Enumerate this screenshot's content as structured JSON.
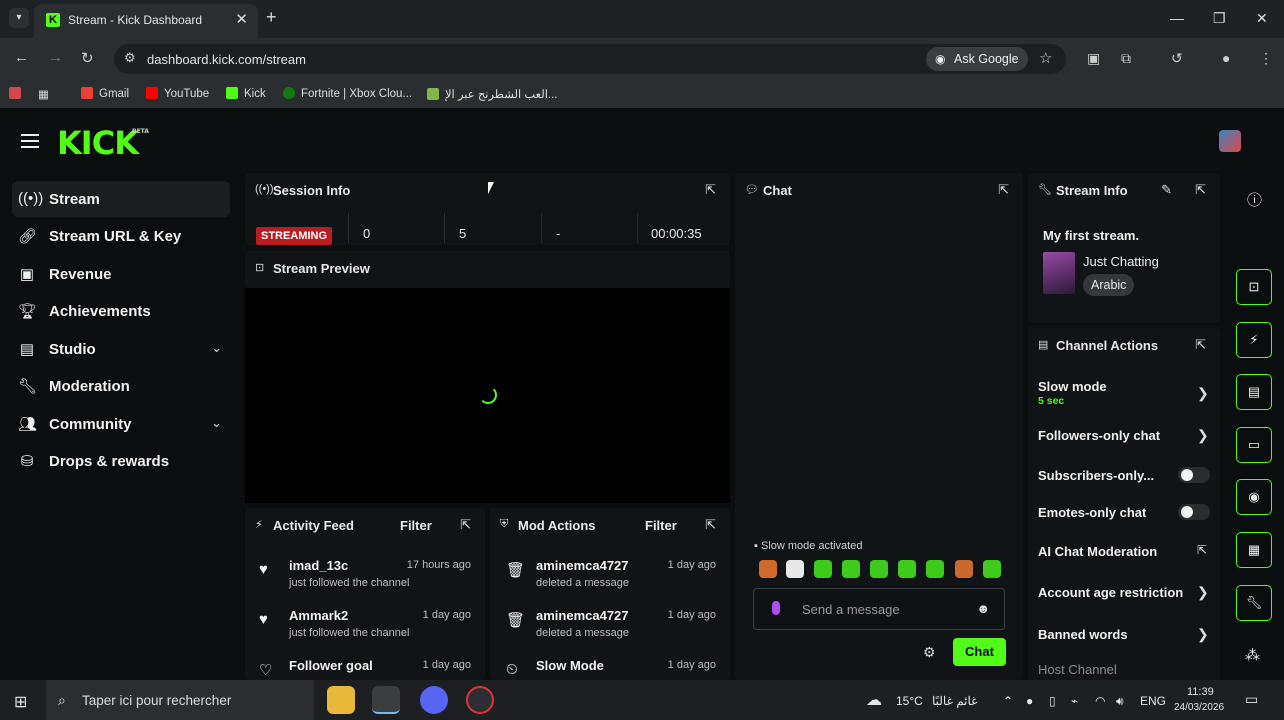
{
  "browser": {
    "tab_title": "Stream - Kick Dashboard",
    "tab_favicon": "K",
    "url": "dashboard.kick.com/stream",
    "ask_google": "Ask Google",
    "bookmarks": [
      {
        "label": "Gmail",
        "color": "#ea4335"
      },
      {
        "label": "YouTube",
        "color": "#ff0000"
      },
      {
        "label": "Kick",
        "color": "#53fc18"
      },
      {
        "label": "Fortnite | Xbox Clou...",
        "color": "#107c10"
      },
      {
        "label": "العب الشطرنج عبر الإ...",
        "color": "#81b64c"
      }
    ]
  },
  "app": {
    "logo": "KICK",
    "logo_badge": "BETA",
    "accent": "#53fc18"
  },
  "sidebar": {
    "items": [
      {
        "label": "Stream",
        "icon": "broadcast-icon",
        "active": true
      },
      {
        "label": "Stream URL & Key",
        "icon": "link-icon"
      },
      {
        "label": "Revenue",
        "icon": "dollar-icon"
      },
      {
        "label": "Achievements",
        "icon": "trophy-icon"
      },
      {
        "label": "Studio",
        "icon": "studio-icon",
        "expandable": true
      },
      {
        "label": "Moderation",
        "icon": "wrench-icon"
      },
      {
        "label": "Community",
        "icon": "users-icon",
        "expandable": true
      },
      {
        "label": "Drops & rewards",
        "icon": "gift-icon"
      }
    ]
  },
  "session": {
    "title": "Session Info",
    "status": "STREAMING",
    "viewers": "0",
    "followers": "5",
    "subs": "-",
    "duration": "00:00:35"
  },
  "preview": {
    "title": "Stream Preview"
  },
  "chat": {
    "title": "Chat",
    "notice": "Slow mode activated",
    "placeholder": "Send a message",
    "send": "Chat"
  },
  "activity": {
    "title": "Activity Feed",
    "filter": "Filter",
    "items": [
      {
        "name": "imad_13c",
        "detail": "just followed the channel",
        "time": "17 hours ago"
      },
      {
        "name": "Ammark2",
        "detail": "just followed the channel",
        "time": "1 day ago"
      },
      {
        "name": "Follower goal",
        "detail": "",
        "time": "1 day ago"
      }
    ]
  },
  "mod_actions": {
    "title": "Mod Actions",
    "filter": "Filter",
    "items": [
      {
        "name": "aminemca4727",
        "detail": "deleted a message",
        "time": "1 day ago"
      },
      {
        "name": "aminemca4727",
        "detail": "deleted a message",
        "time": "1 day ago"
      },
      {
        "name": "Slow Mode",
        "detail": "",
        "time": "1 day ago"
      }
    ]
  },
  "stream_info": {
    "title": "Stream Info",
    "stream_title": "My first stream.",
    "category": "Just Chatting",
    "language": "Arabic"
  },
  "channel_actions": {
    "title": "Channel Actions",
    "slow_mode": "Slow mode",
    "slow_mode_value": "5 sec",
    "followers_only": "Followers-only chat",
    "subscribers_only": "Subscribers-only...",
    "emotes_only": "Emotes-only chat",
    "ai_moderation": "AI Chat Moderation",
    "age_restriction": "Account age restriction",
    "banned_words": "Banned words",
    "host_channel": "Host Channel"
  },
  "taskbar": {
    "search": "Taper ici pour rechercher",
    "weather": "15°C",
    "weather_text": "غائم غالبًا",
    "language": "ENG",
    "time": "11:39",
    "date": "24/03/2026"
  }
}
